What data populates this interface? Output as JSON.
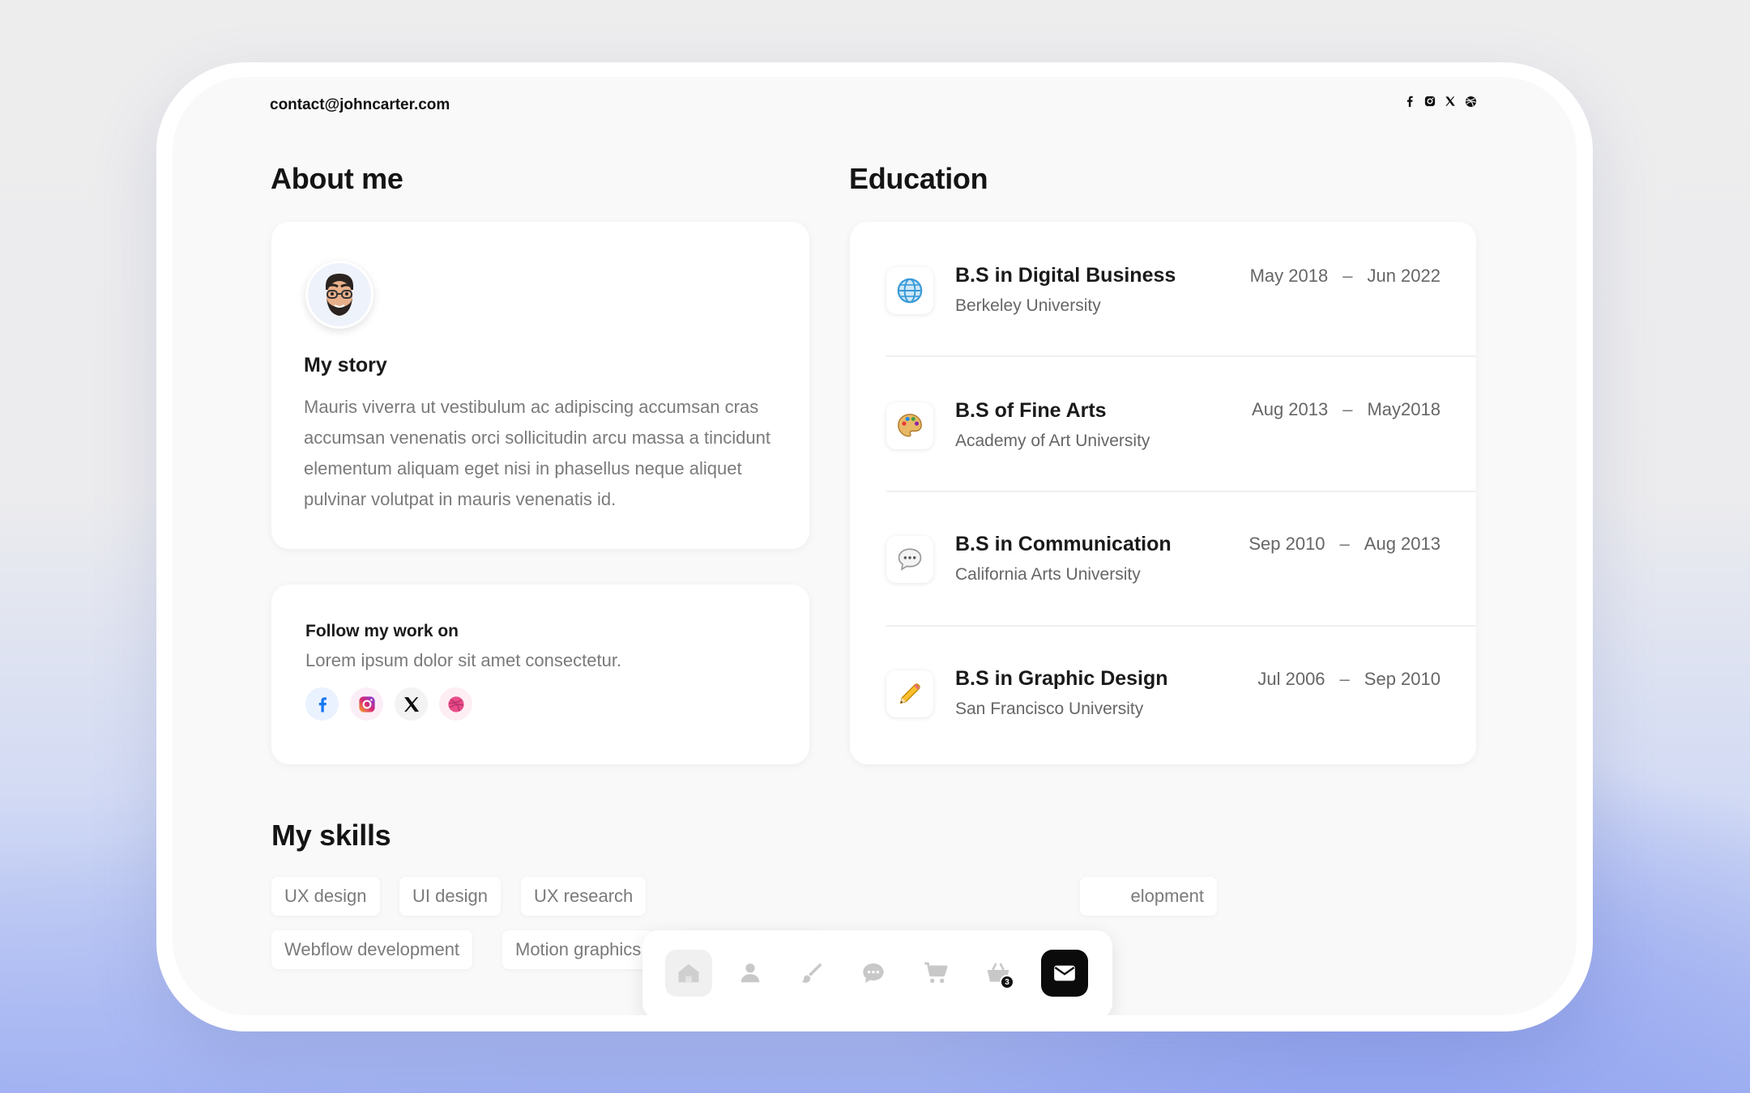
{
  "header": {
    "email": "contact@johncarter.com",
    "social_icons": [
      "facebook-icon",
      "instagram-icon",
      "x-icon",
      "dribbble-icon"
    ]
  },
  "about": {
    "heading": "About me",
    "story_title": "My story",
    "story_text": "Mauris viverra ut vestibulum ac adipiscing accumsan cras accumsan venenatis orci sollicitudin arcu massa a tincidunt elementum aliquam eget nisi in phasellus neque aliquet pulvinar volutpat in mauris venenatis id.",
    "follow_title": "Follow my work on",
    "follow_text": "Lorem ipsum dolor sit amet consectetur."
  },
  "education": {
    "heading": "Education",
    "items": [
      {
        "degree": "B.S in Digital Business",
        "school": "Berkeley University",
        "start": "May 2018",
        "end": "Jun 2022",
        "icon": "globe-icon"
      },
      {
        "degree": "B.S of Fine Arts",
        "school": "Academy of Art University",
        "start": "Aug 2013",
        "end": "May2018",
        "icon": "palette-icon"
      },
      {
        "degree": "B.S in Communication",
        "school": "California Arts University",
        "start": "Sep 2010",
        "end": "Aug 2013",
        "icon": "speech-bubble-icon"
      },
      {
        "degree": "B.S in Graphic Design",
        "school": "San Francisco University",
        "start": "Jul 2006",
        "end": "Sep 2010",
        "icon": "pencil-icon"
      }
    ],
    "separator": "–"
  },
  "skills": {
    "heading": "My skills",
    "row1": [
      "UX design",
      "UI design",
      "UX research",
      "elopment"
    ],
    "row2": [
      "Webflow development",
      "Motion graphics"
    ]
  },
  "dock": {
    "items": [
      "home-icon",
      "user-icon",
      "brush-icon",
      "chat-icon",
      "cart-icon",
      "basket-icon",
      "mail-icon"
    ],
    "basket_badge": "3",
    "active": "mail-icon"
  },
  "colors": {
    "accent_dark": "#0b0b0b",
    "facebook": "#1877f2",
    "instagram": "#d62976",
    "dribbble": "#ea4c89"
  }
}
